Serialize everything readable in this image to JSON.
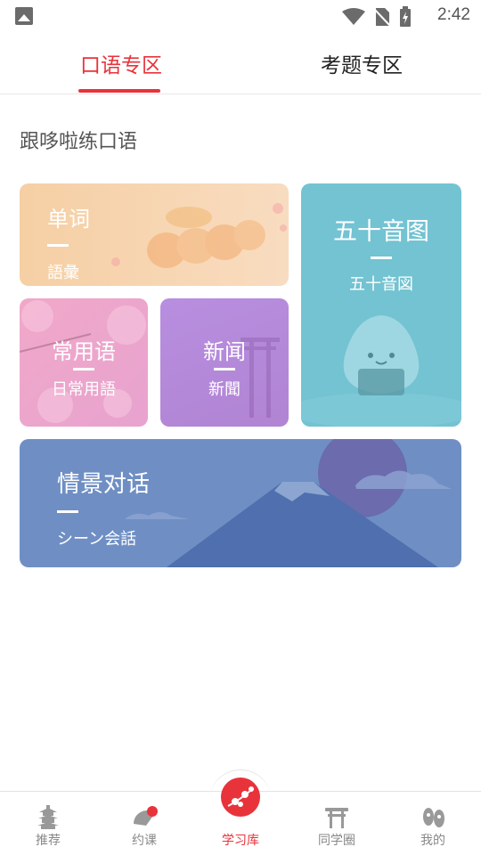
{
  "status_bar": {
    "time": "2:42"
  },
  "tabs": [
    {
      "label": "口语专区",
      "active": true
    },
    {
      "label": "考题专区",
      "active": false
    }
  ],
  "section_title": "跟哆啦练口语",
  "cards": {
    "words": {
      "title": "单词",
      "subtitle": "語彙"
    },
    "gojuon": {
      "title": "五十音图",
      "subtitle": "五十音図"
    },
    "phrases": {
      "title": "常用语",
      "subtitle": "日常用語"
    },
    "news": {
      "title": "新闻",
      "subtitle": "新聞"
    },
    "dialog": {
      "title": "情景对话",
      "subtitle": "シーン会話"
    }
  },
  "bottom_nav": [
    {
      "label": "推荐",
      "icon": "pagoda-icon",
      "active": false
    },
    {
      "label": "约课",
      "icon": "fan-icon",
      "active": false
    },
    {
      "label": "学习库",
      "icon": "sakura-branch-icon",
      "active": true
    },
    {
      "label": "同学圈",
      "icon": "torii-icon",
      "active": false
    },
    {
      "label": "我的",
      "icon": "geta-icon",
      "active": false
    }
  ],
  "colors": {
    "accent": "#e8333b",
    "words_card": "#f6cfa4",
    "gojuon_card": "#73c3d2",
    "phrases_card": "#f1a8c9",
    "news_card": "#b88ee0",
    "dialog_card": "#6f8fc4"
  }
}
